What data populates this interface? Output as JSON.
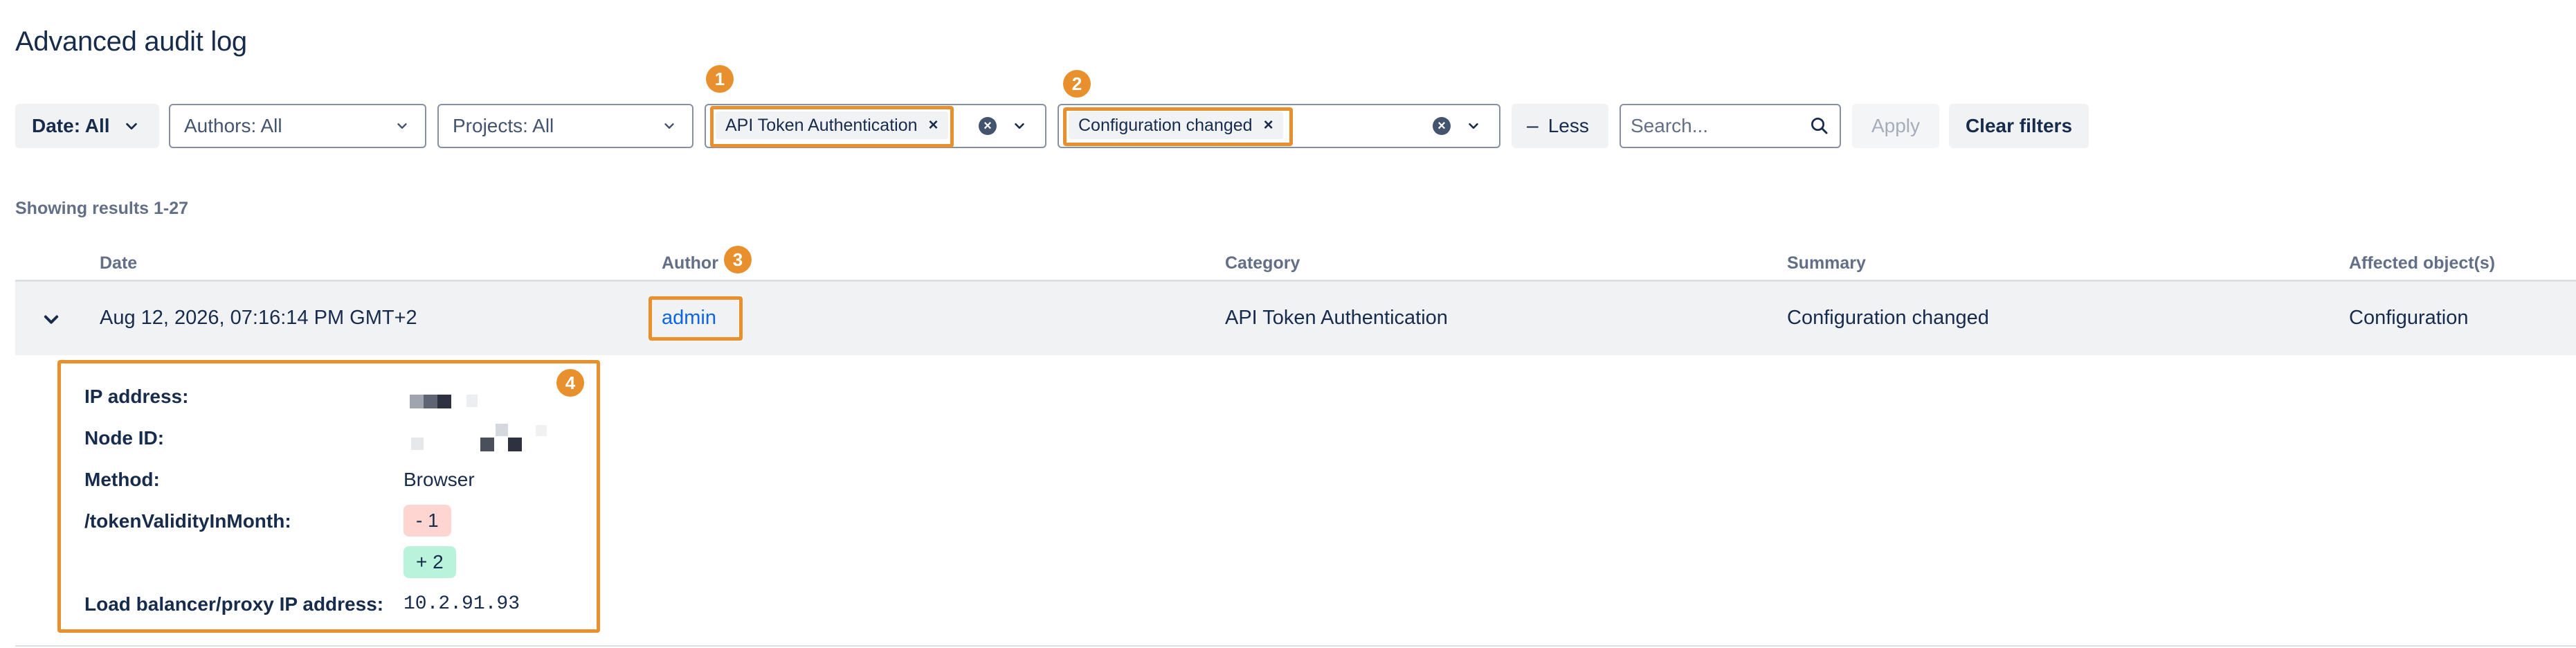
{
  "page": {
    "title": "Advanced audit log"
  },
  "filters": {
    "date": "Date: All",
    "authors": "Authors: All",
    "projects": "Projects: All",
    "category_tag": "API Token Authentication",
    "summary_tag": "Configuration changed",
    "less_label": "Less",
    "search_placeholder": "Search...",
    "apply_label": "Apply",
    "clear_label": "Clear filters"
  },
  "results": {
    "showing": "Showing results 1-27"
  },
  "table": {
    "columns": [
      "Date",
      "Author",
      "Category",
      "Summary",
      "Affected object(s)"
    ],
    "row": {
      "date": "Aug 12, 2026, 07:16:14 PM GMT+2",
      "author": "admin",
      "category": "API Token Authentication",
      "summary": "Configuration changed",
      "affected": "Configuration"
    }
  },
  "details": {
    "ip_label": "IP address:",
    "node_label": "Node ID:",
    "method_label": "Method:",
    "method_value": "Browser",
    "token_label": "/tokenValidityInMonth:",
    "old_value": "- 1",
    "new_value": "+ 2",
    "lb_label": "Load balancer/proxy IP address:",
    "lb_value": "10.2.91.93"
  },
  "annotations": [
    "1",
    "2",
    "3",
    "4"
  ],
  "colors": {
    "highlight": "#e8902e",
    "link": "#0c66e4",
    "text": "#172b4d",
    "row_bg": "#f1f2f4",
    "removed": "#ffd5d2",
    "added": "#baf3db"
  }
}
